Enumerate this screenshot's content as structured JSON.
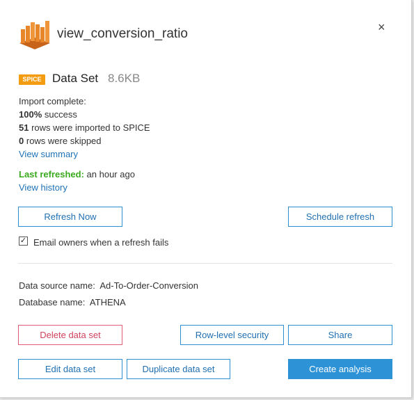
{
  "header": {
    "title": "view_conversion_ratio",
    "logo_icon": "quicksight-bars-icon",
    "close_label": "×"
  },
  "dataset": {
    "badge": "SPICE",
    "label": "Data Set",
    "size": "8.6KB"
  },
  "import": {
    "status": "Import complete:",
    "success_value": "100%",
    "success_text": "success",
    "rows_imported_value": "51",
    "rows_imported_text": "rows were imported to SPICE",
    "rows_skipped_value": "0",
    "rows_skipped_text": "rows were skipped",
    "view_summary": "View summary"
  },
  "refresh": {
    "last_label": "Last refreshed:",
    "last_value": "an hour ago",
    "view_history": "View history",
    "refresh_now": "Refresh Now",
    "schedule_refresh": "Schedule refresh",
    "email_checked": true,
    "email_label": "Email owners when a refresh fails"
  },
  "source": {
    "data_source_label": "Data source name:",
    "data_source_value": "Ad-To-Order-Conversion",
    "database_label": "Database name:",
    "database_value": "ATHENA"
  },
  "actions": {
    "delete": "Delete data set",
    "row_level_security": "Row-level security",
    "share": "Share",
    "edit": "Edit data set",
    "duplicate": "Duplicate data set",
    "create_analysis": "Create analysis"
  },
  "colors": {
    "accent": "#2e93d6",
    "badge": "#f39c12",
    "danger": "#d0415d",
    "success": "#3aaa1e",
    "logo": "#e8862a"
  }
}
